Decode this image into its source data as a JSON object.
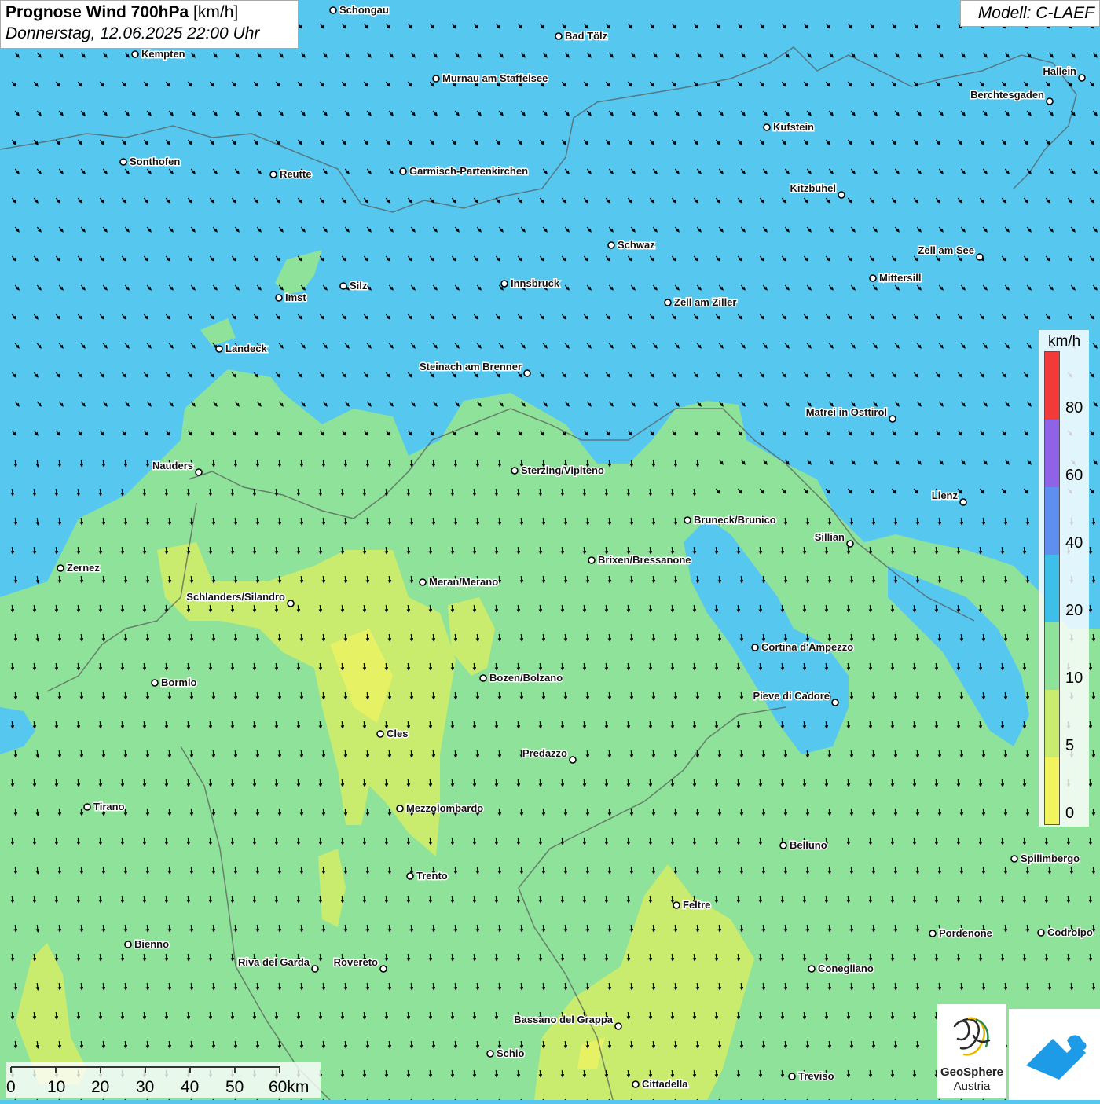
{
  "title": {
    "product_bold": "Prognose Wind 700hPa",
    "unit": "[km/h]",
    "datetime": "Donnerstag, 12.06.2025 22:00 Uhr"
  },
  "model": "Modell: C-LAEF",
  "colors": {
    "wind_20_40": "#56c8ef",
    "wind_10_20": "#8ee29a",
    "wind_5_10": "#c9ec6e",
    "wind_0_5": "#f2f45e",
    "wind_40_60": "#5e8ef0",
    "wind_60_80": "#8f62e8",
    "wind_80_plus": "#f23a3a",
    "arrow": "#000000"
  },
  "legend": {
    "unit": "km/h",
    "ticks": [
      "80",
      "60",
      "40",
      "20",
      "10",
      "5",
      "0"
    ]
  },
  "scale_bar": {
    "labels": [
      "0",
      "10",
      "20",
      "30",
      "40",
      "50",
      "60km"
    ]
  },
  "logos": {
    "geosphere_line1": "GeoSphere",
    "geosphere_line2": "Austria",
    "geosphere_icon": "geosphere-logo-icon",
    "app_icon": "warning-app-icon"
  },
  "cities": [
    {
      "name": "Schongau",
      "id": "schongau"
    },
    {
      "name": "Bad Tölz",
      "id": "bad-toelz"
    },
    {
      "name": "Kempten",
      "id": "kempten"
    },
    {
      "name": "Murnau am Staffelsee",
      "id": "murnau"
    },
    {
      "name": "Hallein",
      "id": "hallein"
    },
    {
      "name": "Berchtesgaden",
      "id": "berchtesgaden"
    },
    {
      "name": "Kufstein",
      "id": "kufstein"
    },
    {
      "name": "Sonthofen",
      "id": "sonthofen"
    },
    {
      "name": "Reutte",
      "id": "reutte"
    },
    {
      "name": "Garmisch-Partenkirchen",
      "id": "garmisch"
    },
    {
      "name": "Kitzbühel",
      "id": "kitzbuehel"
    },
    {
      "name": "Schwaz",
      "id": "schwaz"
    },
    {
      "name": "Zell am See",
      "id": "zell-am-see"
    },
    {
      "name": "Mittersill",
      "id": "mittersill"
    },
    {
      "name": "Innsbruck",
      "id": "innsbruck"
    },
    {
      "name": "Silz",
      "id": "silz"
    },
    {
      "name": "Imst",
      "id": "imst"
    },
    {
      "name": "Zell am Ziller",
      "id": "zell-am-ziller"
    },
    {
      "name": "Landeck",
      "id": "landeck"
    },
    {
      "name": "Steinach am Brenner",
      "id": "steinach"
    },
    {
      "name": "Matrei in Osttirol",
      "id": "matrei"
    },
    {
      "name": "Nauders",
      "id": "nauders"
    },
    {
      "name": "Sterzing/Vipiteno",
      "id": "sterzing"
    },
    {
      "name": "Lienz",
      "id": "lienz"
    },
    {
      "name": "Bruneck/Brunico",
      "id": "bruneck"
    },
    {
      "name": "Sillian",
      "id": "sillian"
    },
    {
      "name": "Brixen/Bressanone",
      "id": "brixen"
    },
    {
      "name": "Zernez",
      "id": "zernez"
    },
    {
      "name": "Meran/Merano",
      "id": "meran"
    },
    {
      "name": "Schlanders/Silandro",
      "id": "schlanders"
    },
    {
      "name": "Cortina d'Ampezzo",
      "id": "cortina"
    },
    {
      "name": "Bozen/Bolzano",
      "id": "bozen"
    },
    {
      "name": "Bormio",
      "id": "bormio"
    },
    {
      "name": "Pieve di Cadore",
      "id": "pieve-di-cadore"
    },
    {
      "name": "Cles",
      "id": "cles"
    },
    {
      "name": "Predazzo",
      "id": "predazzo"
    },
    {
      "name": "Tirano",
      "id": "tirano"
    },
    {
      "name": "Mezzolombardo",
      "id": "mezzolombardo"
    },
    {
      "name": "Belluno",
      "id": "belluno"
    },
    {
      "name": "Spilimbergo",
      "id": "spilimbergo"
    },
    {
      "name": "Trento",
      "id": "trento"
    },
    {
      "name": "Feltre",
      "id": "feltre"
    },
    {
      "name": "Pordenone",
      "id": "pordenone"
    },
    {
      "name": "Codroipo",
      "id": "codroipo"
    },
    {
      "name": "Bienno",
      "id": "bienno"
    },
    {
      "name": "Riva del Garda",
      "id": "riva"
    },
    {
      "name": "Rovereto",
      "id": "rovereto"
    },
    {
      "name": "Conegliano",
      "id": "conegliano"
    },
    {
      "name": "Bassano del Grappa",
      "id": "bassano"
    },
    {
      "name": "Schio",
      "id": "schio"
    },
    {
      "name": "Treviso",
      "id": "treviso"
    },
    {
      "name": "Cittadella",
      "id": "cittadella"
    }
  ]
}
